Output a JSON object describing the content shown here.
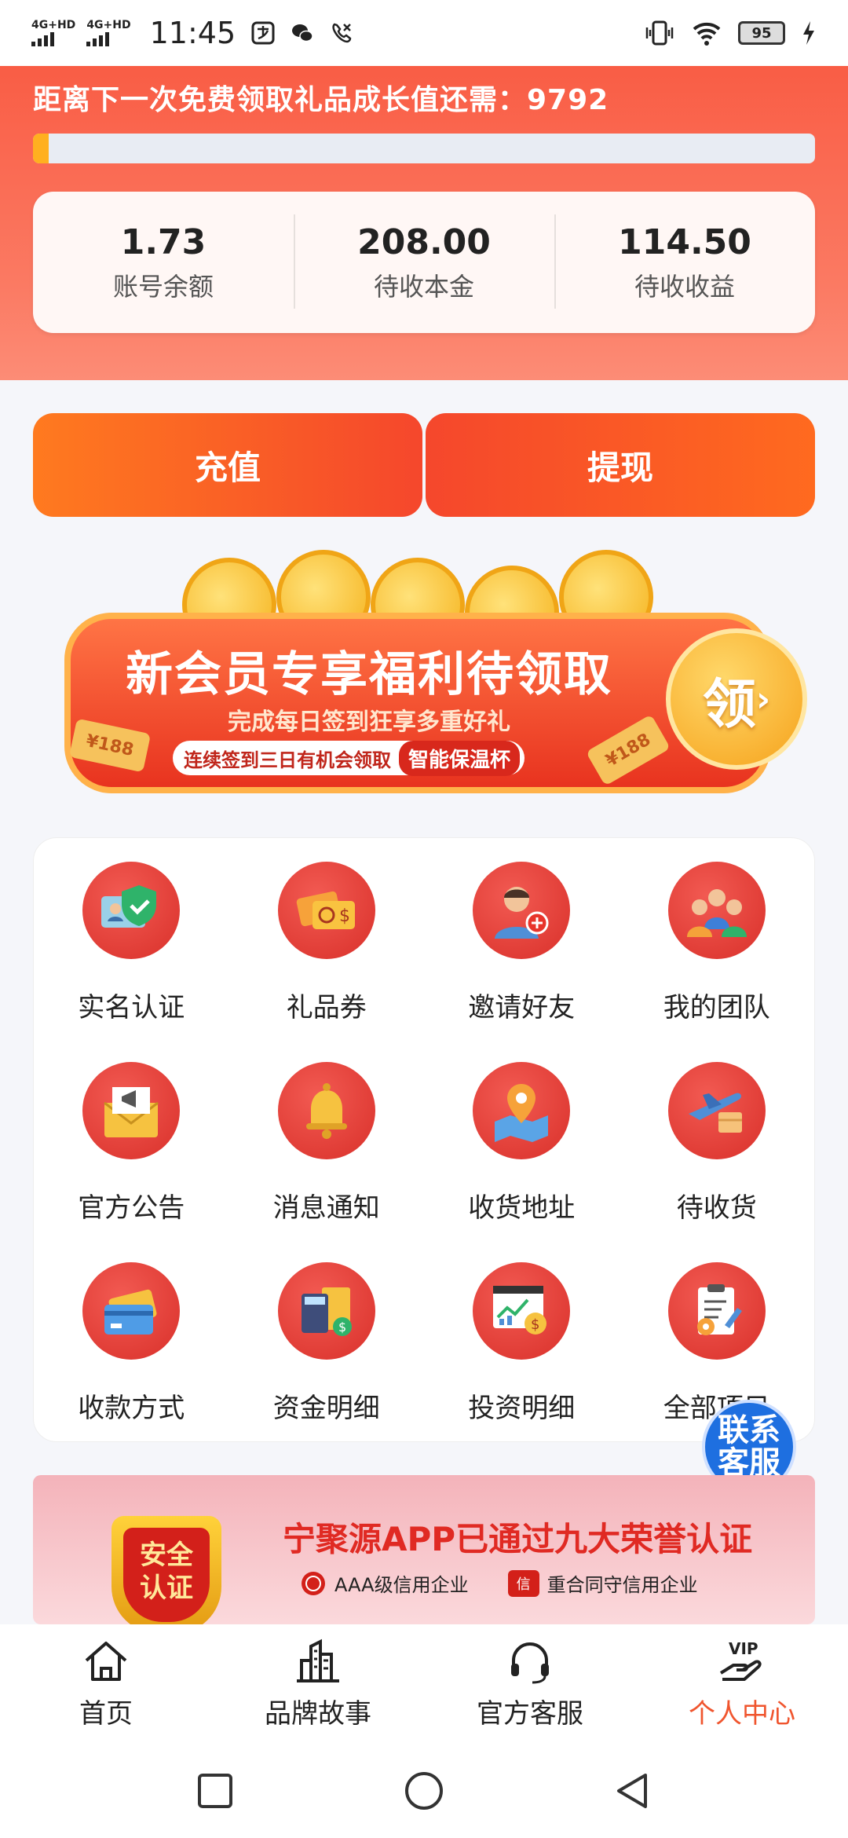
{
  "status_bar": {
    "carrier1": "4G+HD",
    "carrier2": "4G+HD",
    "time": "11:45",
    "battery": "95"
  },
  "header": {
    "growth_text": "距离下一次免费领取礼品成长值还需：9792",
    "progress_fraction": 0.02,
    "stats": [
      {
        "value": "1.73",
        "label": "账号余额"
      },
      {
        "value": "208.00",
        "label": "待收本金"
      },
      {
        "value": "114.50",
        "label": "待收收益"
      }
    ]
  },
  "actions": {
    "recharge": "充值",
    "withdraw": "提现"
  },
  "promo_banner": {
    "title": "新会员专享福利待领取",
    "subtitle": "完成每日签到狂享多重好礼",
    "pill_text": "连续签到三日有机会领取",
    "pill_highlight": "智能保温杯",
    "claim": "领",
    "claim_arrow": "›",
    "tag": "¥188"
  },
  "menu": [
    {
      "label": "实名认证",
      "icon": "id-card-shield-icon"
    },
    {
      "label": "礼品券",
      "icon": "gift-coupon-icon"
    },
    {
      "label": "邀请好友",
      "icon": "invite-friend-icon"
    },
    {
      "label": "我的团队",
      "icon": "team-icon"
    },
    {
      "label": "官方公告",
      "icon": "announcement-icon"
    },
    {
      "label": "消息通知",
      "icon": "bell-icon"
    },
    {
      "label": "收货地址",
      "icon": "map-pin-icon"
    },
    {
      "label": "待收货",
      "icon": "airplane-delivery-icon"
    },
    {
      "label": "收款方式",
      "icon": "credit-card-icon"
    },
    {
      "label": "资金明细",
      "icon": "calculator-doc-icon"
    },
    {
      "label": "投资明细",
      "icon": "investment-chart-icon"
    },
    {
      "label": "全部项目",
      "icon": "clipboard-gear-icon"
    }
  ],
  "contact_fab": {
    "line1": "联系",
    "line2": "客服"
  },
  "cert_banner": {
    "shield_line1": "安全",
    "shield_line2": "认证",
    "title": "宁聚源APP已通过九大荣誉认证",
    "item1": "AAA级信用企业",
    "item2": "重合同守信用企业",
    "badge2": "信"
  },
  "bottom_nav": [
    {
      "label": "首页",
      "icon": "home-icon"
    },
    {
      "label": "品牌故事",
      "icon": "building-icon"
    },
    {
      "label": "官方客服",
      "icon": "headset-icon"
    },
    {
      "label": "个人中心",
      "icon": "vip-hand-icon",
      "vip": "VIP"
    }
  ],
  "colors": {
    "accent": "#f95d45",
    "active_nav": "#f0552e",
    "fab": "#1e6fe0"
  }
}
